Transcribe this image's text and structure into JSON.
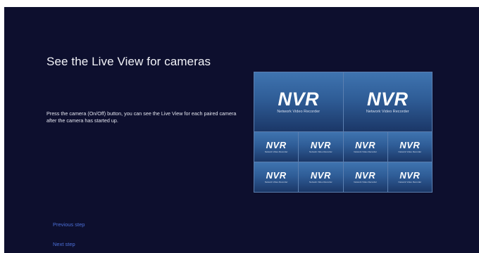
{
  "screen": {
    "title": "See the Live View for cameras",
    "description": "Press the camera (On/Off) button, you can see the Live View for each paired camera after the camera has started up."
  },
  "preview": {
    "big_tiles": [
      {
        "logo": "NVR",
        "subtitle": "Network Video Recorder"
      },
      {
        "logo": "NVR",
        "subtitle": "Network Video Recorder"
      }
    ],
    "small_tiles": [
      {
        "logo": "NVR",
        "subtitle": "Network Video Recorder"
      },
      {
        "logo": "NVR",
        "subtitle": "Network Video Recorder"
      },
      {
        "logo": "NVR",
        "subtitle": "Network Video Recorder"
      },
      {
        "logo": "NVR",
        "subtitle": "Network Video Recorder"
      },
      {
        "logo": "NVR",
        "subtitle": "Network Video Recorder"
      },
      {
        "logo": "NVR",
        "subtitle": "Network Video Recorder"
      },
      {
        "logo": "NVR",
        "subtitle": "Network Video Recorder"
      },
      {
        "logo": "NVR",
        "subtitle": "Network Video Recorder"
      }
    ]
  },
  "nav": {
    "previous_label": "Previous step",
    "next_label": "Next step"
  },
  "colors": {
    "background": "#0d0f2e",
    "link": "#4b6fd8",
    "tile_top": "#3f74b0",
    "tile_bottom": "#1b3767"
  }
}
